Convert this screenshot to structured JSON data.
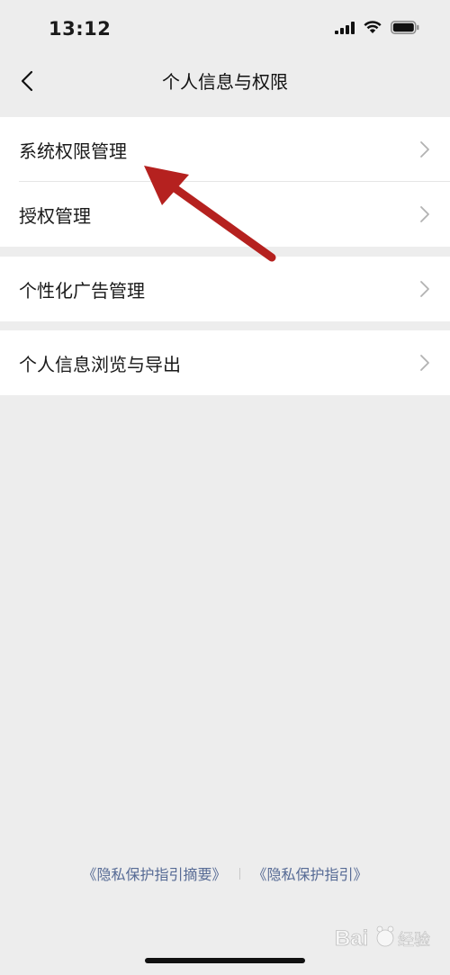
{
  "status_bar": {
    "time": "13:12"
  },
  "nav": {
    "title": "个人信息与权限"
  },
  "groups": [
    {
      "items": [
        {
          "label": "系统权限管理"
        },
        {
          "label": "授权管理"
        }
      ]
    },
    {
      "items": [
        {
          "label": "个性化广告管理"
        }
      ]
    },
    {
      "items": [
        {
          "label": "个人信息浏览与导出"
        }
      ]
    }
  ],
  "footer": {
    "link_summary": "《隐私保护指引摘要》",
    "link_full": "《隐私保护指引》"
  },
  "watermark": {
    "text": "Bai 经验"
  },
  "colors": {
    "background": "#ededed",
    "cell": "#ffffff",
    "link": "#576b95",
    "annotation_arrow": "#b5211f"
  }
}
